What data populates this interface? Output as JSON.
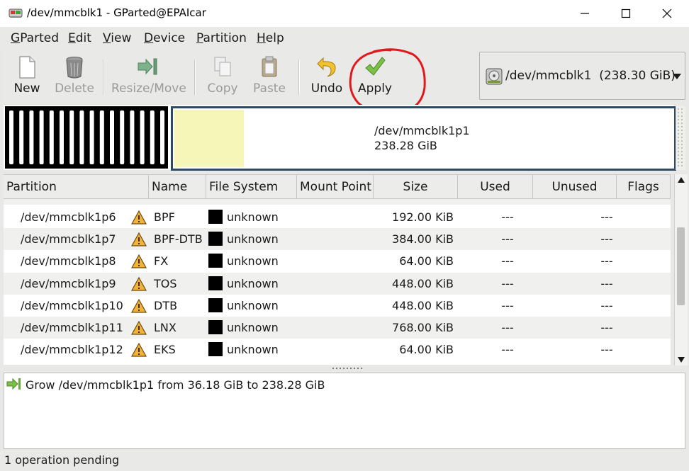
{
  "window": {
    "title": "/dev/mmcblk1 - GParted@EPAIcar"
  },
  "menu": [
    {
      "pre": "G",
      "rest": "Parted"
    },
    {
      "pre": "E",
      "rest": "dit"
    },
    {
      "pre": "V",
      "rest": "iew"
    },
    {
      "pre": "D",
      "rest": "evice"
    },
    {
      "pre": "P",
      "rest": "artition"
    },
    {
      "pre": "H",
      "rest": "elp"
    }
  ],
  "toolbar": {
    "new_label": "New",
    "delete_label": "Delete",
    "resize_label": "Resize/Move",
    "copy_label": "Copy",
    "paste_label": "Paste",
    "undo_label": "Undo",
    "apply_label": "Apply"
  },
  "device": {
    "label": "/dev/mmcblk1  (238.30 GiB)"
  },
  "disk_graphic": {
    "partition_name": "/dev/mmcblk1p1",
    "partition_size": "238.28 GiB",
    "used_color": "#f7f6b9",
    "frame_color": "#2c4a66"
  },
  "table": {
    "columns": {
      "partition": "Partition",
      "name": "Name",
      "filesystem": "File System",
      "mountpoint": "Mount Point",
      "size": "Size",
      "used": "Used",
      "unused": "Unused",
      "flags": "Flags"
    },
    "rows": [
      {
        "partition": "/dev/mmcblk1p6",
        "name": "BPF",
        "fs": "unknown",
        "size": "192.00 KiB",
        "used": "---",
        "unused": "---"
      },
      {
        "partition": "/dev/mmcblk1p7",
        "name": "BPF-DTB",
        "fs": "unknown",
        "size": "384.00 KiB",
        "used": "---",
        "unused": "---"
      },
      {
        "partition": "/dev/mmcblk1p8",
        "name": "FX",
        "fs": "unknown",
        "size": "64.00 KiB",
        "used": "---",
        "unused": "---"
      },
      {
        "partition": "/dev/mmcblk1p9",
        "name": "TOS",
        "fs": "unknown",
        "size": "448.00 KiB",
        "used": "---",
        "unused": "---"
      },
      {
        "partition": "/dev/mmcblk1p10",
        "name": "DTB",
        "fs": "unknown",
        "size": "448.00 KiB",
        "used": "---",
        "unused": "---"
      },
      {
        "partition": "/dev/mmcblk1p11",
        "name": "LNX",
        "fs": "unknown",
        "size": "768.00 KiB",
        "used": "---",
        "unused": "---"
      },
      {
        "partition": "/dev/mmcblk1p12",
        "name": "EKS",
        "fs": "unknown",
        "size": "64.00 KiB",
        "used": "---",
        "unused": "---"
      }
    ]
  },
  "operations": [
    {
      "text": "Grow /dev/mmcblk1p1 from 36.18 GiB to 238.28 GiB"
    }
  ],
  "status": {
    "text": "1 operation pending"
  },
  "colors": {
    "annotation": "#e0191c",
    "warning": "#f2b233"
  }
}
